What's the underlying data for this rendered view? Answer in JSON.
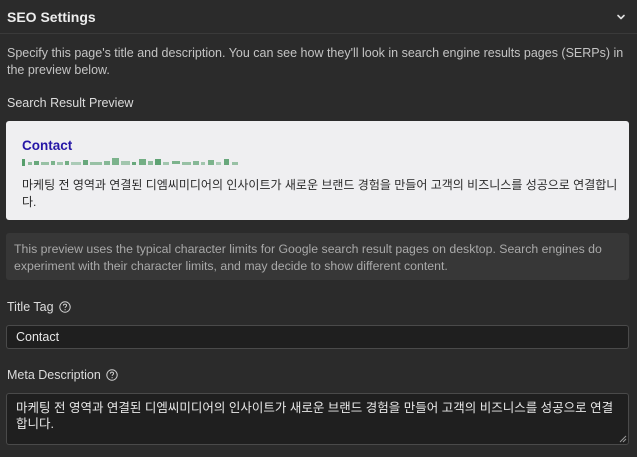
{
  "header": {
    "title": "SEO Settings",
    "collapse_icon": "chevron-down-icon"
  },
  "intro": "Specify this page's title and description. You can see how they'll look in search engine results pages (SERPs) in the preview below.",
  "preview": {
    "section_label": "Search Result Preview",
    "title": "Contact",
    "url_display": "blurred-url",
    "description": "마케팅 전 영역과 연결된 디엠씨미디어의 인사이트가 새로운 브랜드 경험을 만들어 고객의 비즈니스를 성공으로 연결합니다."
  },
  "notice": "This preview uses the typical character limits for Google search result pages on desktop. Search engines do experiment with their character limits, and may decide to show different content.",
  "title_tag": {
    "label": "Title Tag",
    "value": "Contact",
    "help_icon": "help-circle-icon"
  },
  "meta_description": {
    "label": "Meta Description",
    "value": "마케팅 전 영역과 연결된 디엠씨미디어의 인사이트가 새로운 브랜드 경험을 만들어 고객의 비즈니스를 성공으로 연결합니다.",
    "help_icon": "help-circle-icon"
  },
  "colors": {
    "background": "#2b2b2b",
    "preview_bg": "#efeff1",
    "preview_title": "#2516a6",
    "url_green": "#2f8a4a"
  }
}
